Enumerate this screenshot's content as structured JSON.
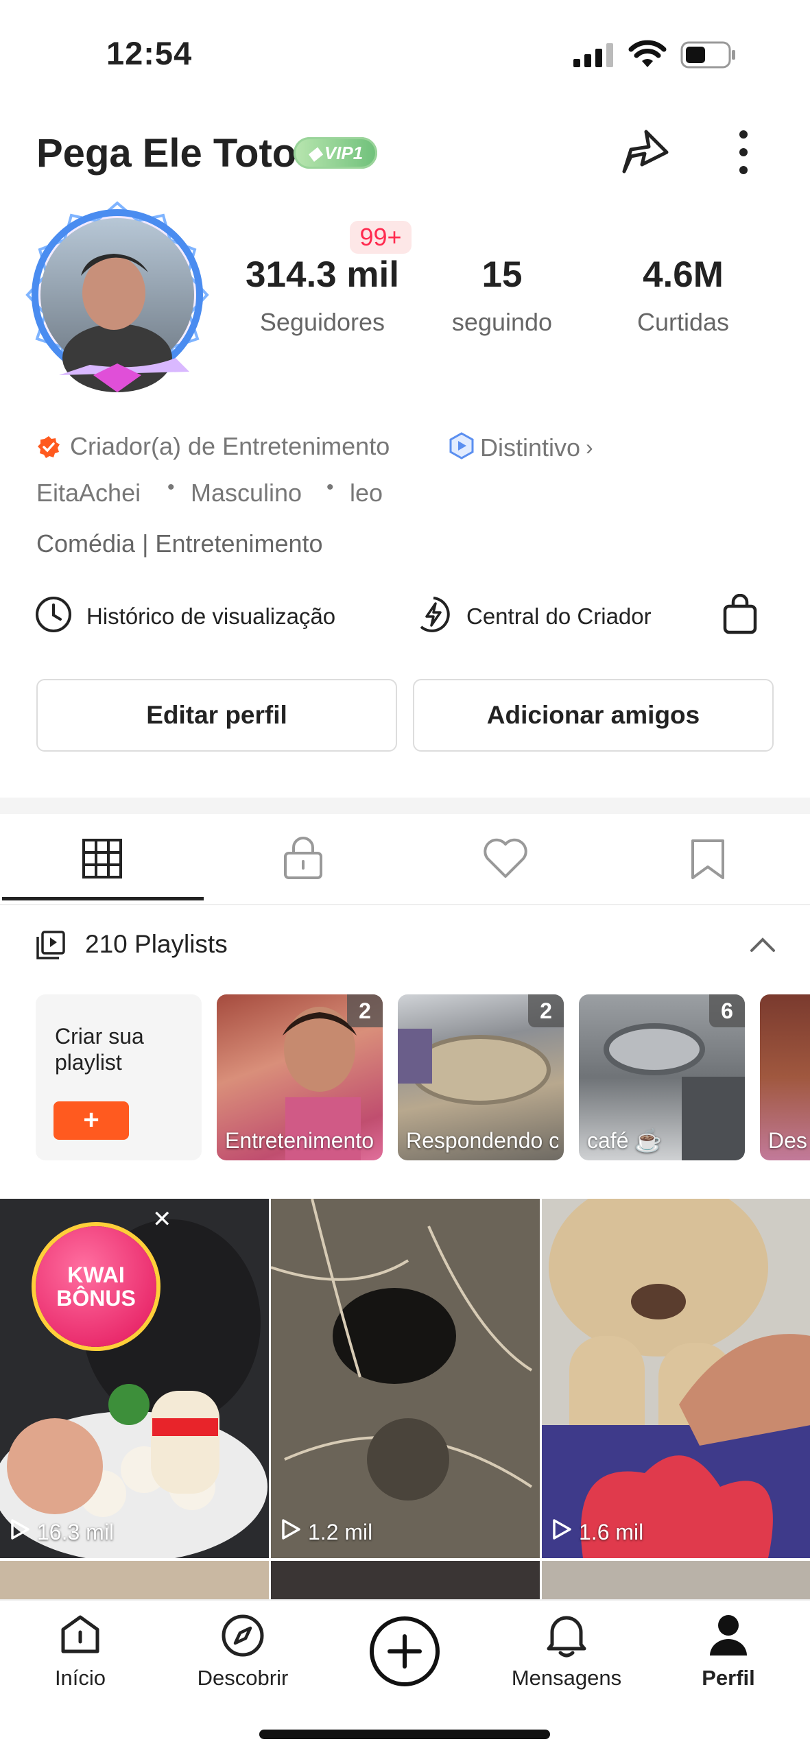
{
  "status_bar": {
    "time": "12:54"
  },
  "profile": {
    "name": "Pega Ele Toto",
    "vip_label": "VIP1",
    "notification_badge": "99+",
    "stats": [
      {
        "value": "314.3 mil",
        "label": "Seguidores"
      },
      {
        "value": "15",
        "label": "seguindo"
      },
      {
        "value": "4.6M",
        "label": "Curtidas"
      }
    ],
    "creator_type": "Criador(a) de Entretenimento",
    "badge_link": "Distintivo",
    "tags": [
      "EitaAchei",
      "Masculino",
      "leo"
    ],
    "bio": "Comédia | Entretenimento"
  },
  "tools": {
    "history": "Histórico de visualização",
    "creator_center": "Central do Criador"
  },
  "buttons": {
    "edit": "Editar perfil",
    "add_friends": "Adicionar amigos"
  },
  "playlists": {
    "title": "210 Playlists",
    "create_label": "Criar sua playlist",
    "create_button": "+",
    "items": [
      {
        "name": "Entretenimento",
        "count": "2"
      },
      {
        "name": "Respondendo comentários...",
        "count": "2"
      },
      {
        "name": "café ☕",
        "count": "6"
      },
      {
        "name": "Des"
      }
    ]
  },
  "videos": [
    {
      "views": "16.3 mil",
      "promo": "KWAI BÔNUS"
    },
    {
      "views": "1.2 mil"
    },
    {
      "views": "1.6 mil"
    }
  ],
  "bottom_nav": {
    "home": "Início",
    "discover": "Descobrir",
    "messages": "Mensagens",
    "profile": "Perfil"
  },
  "colors": {
    "accent": "#ff5a1f",
    "badge_red": "#ff2b4f"
  }
}
